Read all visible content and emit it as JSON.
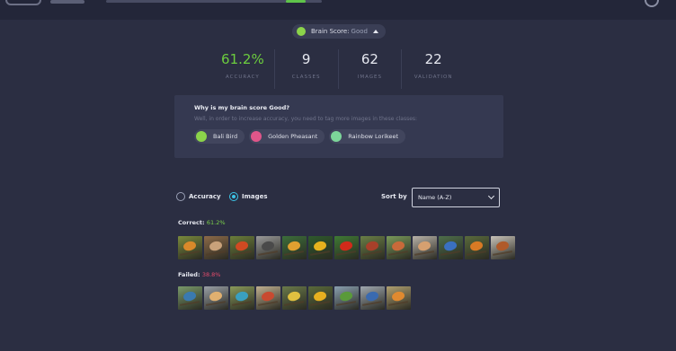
{
  "score": {
    "label": "Brain Score:",
    "value": "Good"
  },
  "stats": [
    {
      "value": "61.2%",
      "label": "ACCURACY",
      "highlight": true
    },
    {
      "value": "9",
      "label": "CLASSES",
      "highlight": false
    },
    {
      "value": "62",
      "label": "IMAGES",
      "highlight": false
    },
    {
      "value": "22",
      "label": "VALIDATION",
      "highlight": false
    }
  ],
  "why": {
    "title": "Why is my brain score Good?",
    "subtitle": "Well, in order to increase accuracy, you need to tag more images in these classes:",
    "classes": [
      {
        "name": "Bali Bird",
        "color": "#8bd34a"
      },
      {
        "name": "Golden Pheasant",
        "color": "#e0568a"
      },
      {
        "name": "Rainbow Lorikeet",
        "color": "#7cd69a"
      }
    ]
  },
  "filters": {
    "options": [
      {
        "label": "Accuracy",
        "selected": false
      },
      {
        "label": "Images",
        "selected": true
      }
    ],
    "sort_label": "Sort by",
    "sort_value": "Name (A-Z)"
  },
  "correct": {
    "label": "Correct:",
    "pct": "61.2%",
    "thumbs": [
      {
        "bg": "#7a8a3c",
        "bird": "#d9892a"
      },
      {
        "bg": "#8c6a48",
        "bird": "#c9a27a"
      },
      {
        "bg": "#6b7e3a",
        "bird": "#d04a22"
      },
      {
        "bg": "#9a9a9a",
        "bird": "#4a4a4a"
      },
      {
        "bg": "#3c6e3a",
        "bird": "#e0a030"
      },
      {
        "bg": "#2e5a2c",
        "bird": "#e6b21e"
      },
      {
        "bg": "#3f7a34",
        "bird": "#d12a1a"
      },
      {
        "bg": "#6a7f46",
        "bird": "#a8402a"
      },
      {
        "bg": "#7a9a5a",
        "bird": "#c86a3a"
      },
      {
        "bg": "#b8b2a8",
        "bird": "#d6a070"
      },
      {
        "bg": "#4e6e4a",
        "bird": "#3a70c0"
      },
      {
        "bg": "#5a6a3c",
        "bird": "#d97a24"
      },
      {
        "bg": "#c8c2b8",
        "bird": "#b05a2a"
      }
    ]
  },
  "failed": {
    "label": "Failed:",
    "pct": "38.8%",
    "thumbs": [
      {
        "bg": "#7a9a6a",
        "bird": "#3a7ab0"
      },
      {
        "bg": "#9aa0a6",
        "bird": "#e0b070"
      },
      {
        "bg": "#8a9a5a",
        "bird": "#3aa0c0"
      },
      {
        "bg": "#c0b090",
        "bird": "#c84a30"
      },
      {
        "bg": "#6a7a4a",
        "bird": "#e0c040"
      },
      {
        "bg": "#5a6a3a",
        "bird": "#e6b020"
      },
      {
        "bg": "#8aa0b0",
        "bird": "#5a9a3a"
      },
      {
        "bg": "#a0a8b0",
        "bird": "#3a6ab0"
      },
      {
        "bg": "#b0a070",
        "bird": "#e08a30"
      }
    ]
  }
}
